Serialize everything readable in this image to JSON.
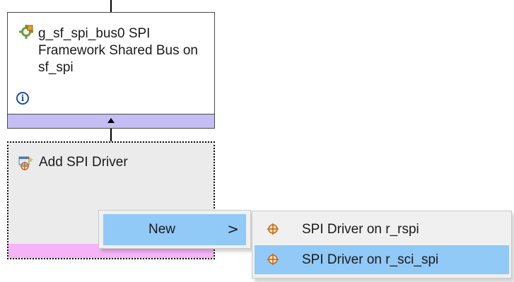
{
  "module": {
    "title": "g_sf_spi_bus0 SPI Framework Shared Bus on sf_spi",
    "info_glyph": "i",
    "icon": "module-gear-icon"
  },
  "add_driver": {
    "label": "Add SPI Driver",
    "icon": "add-driver-icon"
  },
  "context_menu": {
    "items": [
      {
        "label": "New",
        "submenu_indicator": ">"
      }
    ]
  },
  "submenu": {
    "items": [
      {
        "label": "SPI Driver on r_rspi",
        "icon": "driver-crosshair-icon",
        "highlighted": false
      },
      {
        "label": "SPI Driver on r_sci_spi",
        "icon": "driver-crosshair-icon",
        "highlighted": true
      }
    ]
  },
  "colors": {
    "module_footer": "#c4bef5",
    "add_footer": "#f6b3f6",
    "highlight": "#91c9f7",
    "icon_orange": "#d9822b"
  }
}
